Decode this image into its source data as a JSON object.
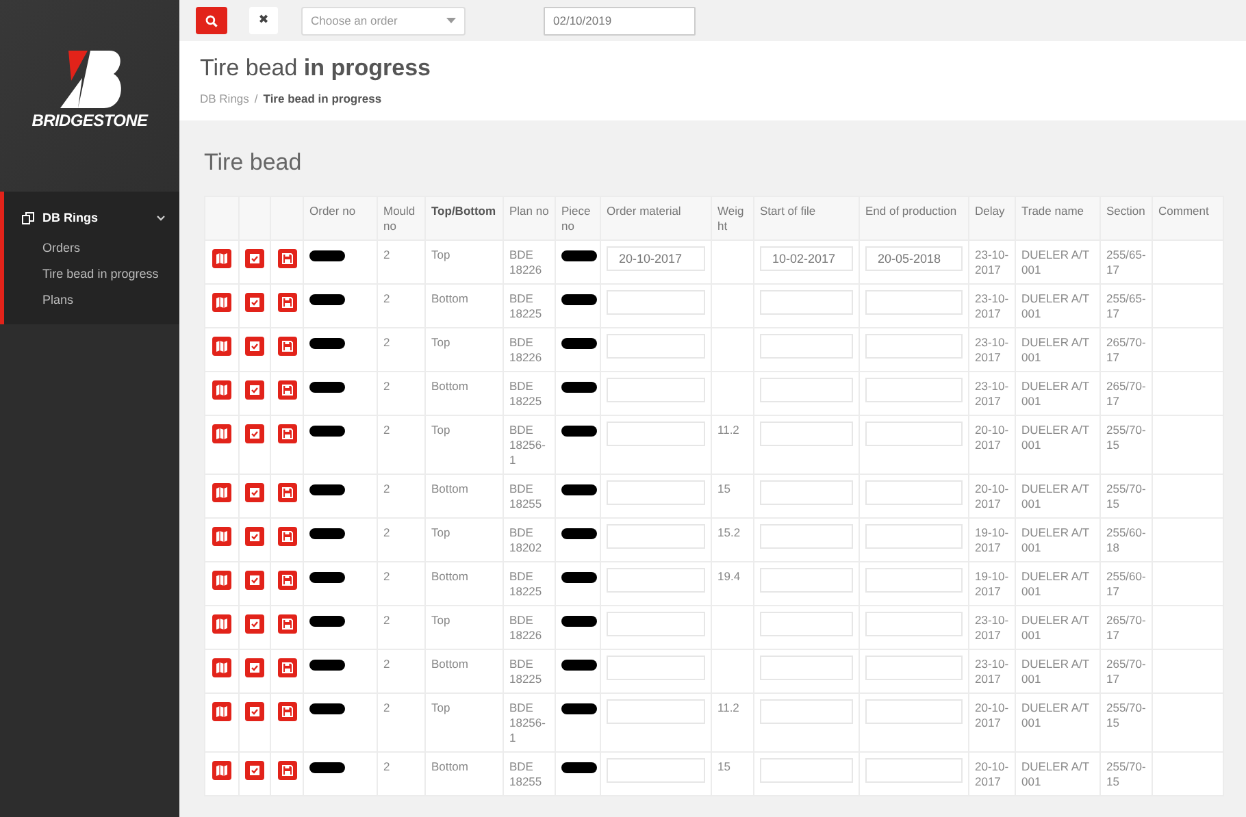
{
  "toolbar": {
    "search_button": {
      "kind": "search"
    },
    "clear_button": {
      "label": "✖"
    },
    "order_select": {
      "placeholder": "Choose an order"
    },
    "date_field": {
      "value": "02/10/2019"
    }
  },
  "sidebar": {
    "brand": "BRIDGESTONE",
    "nav": [
      {
        "label": "DB Rings",
        "selected": true,
        "expanded": true,
        "children": [
          {
            "label": "Orders",
            "selected": false
          },
          {
            "label": "Tire bead in progress",
            "selected": false
          },
          {
            "label": "Plans",
            "selected": false
          }
        ]
      }
    ]
  },
  "header": {
    "title": "Tire bead **in progress**",
    "breadcrumb": [
      {
        "label": "DB Rings",
        "current": false
      },
      {
        "label": "Tire bead in progress",
        "current": true
      }
    ],
    "separator": "/"
  },
  "section_title": "Tire bead",
  "table": {
    "columns": [
      {
        "kind": "action"
      },
      {
        "kind": "action"
      },
      {
        "kind": "action"
      },
      {
        "kind": "redacted",
        "label": "Order no",
        "sorted": false
      },
      {
        "kind": "text",
        "label": "Mould no",
        "sorted": false
      },
      {
        "kind": "text",
        "label": "Top/Bottom",
        "sorted": true
      },
      {
        "kind": "text",
        "label": "Plan no",
        "sorted": false
      },
      {
        "kind": "redacted",
        "label": "Piece no",
        "sorted": false
      },
      {
        "kind": "input",
        "label": "Order material",
        "sorted": false
      },
      {
        "kind": "text",
        "label": "Weig ht",
        "sorted": false
      },
      {
        "kind": "input",
        "label": "Start of file",
        "sorted": false
      },
      {
        "kind": "input",
        "label": "End of production",
        "sorted": false
      },
      {
        "kind": "text",
        "label": "Delay",
        "sorted": false
      },
      {
        "kind": "text",
        "label": "Trade name",
        "sorted": false
      },
      {
        "kind": "text",
        "label": "Section",
        "sorted": false
      },
      {
        "kind": "text",
        "label": "Comment",
        "sorted": false
      }
    ],
    "rows": [
      {
        "cells": [
          null,
          null,
          null,
          null,
          "2",
          "Top",
          "BDE 18226",
          null,
          "20-10-2017",
          null,
          "10-02-2017",
          "20-05-2018",
          "23-10-2017",
          "DUELER A/T 001",
          "255/65-17",
          null
        ]
      },
      {
        "cells": [
          null,
          null,
          null,
          null,
          "2",
          "Bottom",
          "BDE 18225",
          null,
          null,
          null,
          null,
          null,
          "23-10-2017",
          "DUELER A/T 001",
          "255/65-17",
          null
        ]
      },
      {
        "cells": [
          null,
          null,
          null,
          null,
          "2",
          "Top",
          "BDE 18226",
          null,
          null,
          null,
          null,
          null,
          "23-10-2017",
          "DUELER A/T 001",
          "265/70-17",
          null
        ]
      },
      {
        "cells": [
          null,
          null,
          null,
          null,
          "2",
          "Bottom",
          "BDE 18225",
          null,
          null,
          null,
          null,
          null,
          "23-10-2017",
          "DUELER A/T 001",
          "265/70-17",
          null
        ]
      },
      {
        "cells": [
          null,
          null,
          null,
          null,
          "2",
          "Top",
          "BDE 18256-1",
          null,
          null,
          "11.2",
          null,
          null,
          "20-10-2017",
          "DUELER A/T 001",
          "255/70-15",
          null
        ]
      },
      {
        "cells": [
          null,
          null,
          null,
          null,
          "2",
          "Bottom",
          "BDE 18255",
          null,
          null,
          "15",
          null,
          null,
          "20-10-2017",
          "DUELER A/T 001",
          "255/70-15",
          null
        ]
      },
      {
        "cells": [
          null,
          null,
          null,
          null,
          "2",
          "Top",
          "BDE 18202",
          null,
          null,
          "15.2",
          null,
          null,
          "19-10-2017",
          "DUELER A/T 001",
          "255/60-18",
          null
        ]
      },
      {
        "cells": [
          null,
          null,
          null,
          null,
          "2",
          "Bottom",
          "BDE 18225",
          null,
          null,
          "19.4",
          null,
          null,
          "19-10-2017",
          "DUELER A/T 001",
          "255/60-17",
          null
        ]
      },
      {
        "cells": [
          null,
          null,
          null,
          null,
          "2",
          "Top",
          "BDE 18226",
          null,
          null,
          null,
          null,
          null,
          "23-10-2017",
          "DUELER A/T 001",
          "265/70-17",
          null
        ]
      },
      {
        "cells": [
          null,
          null,
          null,
          null,
          "2",
          "Bottom",
          "BDE 18225",
          null,
          null,
          null,
          null,
          null,
          "23-10-2017",
          "DUELER A/T 001",
          "265/70-17",
          null
        ]
      },
      {
        "cells": [
          null,
          null,
          null,
          null,
          "2",
          "Top",
          "BDE 18256-1",
          null,
          null,
          "11.2",
          null,
          null,
          "20-10-2017",
          "DUELER A/T 001",
          "255/70-15",
          null
        ]
      },
      {
        "cells": [
          null,
          null,
          null,
          null,
          "2",
          "Bottom",
          "BDE 18255",
          null,
          null,
          "15",
          null,
          null,
          "20-10-2017",
          "DUELER A/T 001",
          "255/70-15",
          null
        ]
      }
    ]
  }
}
